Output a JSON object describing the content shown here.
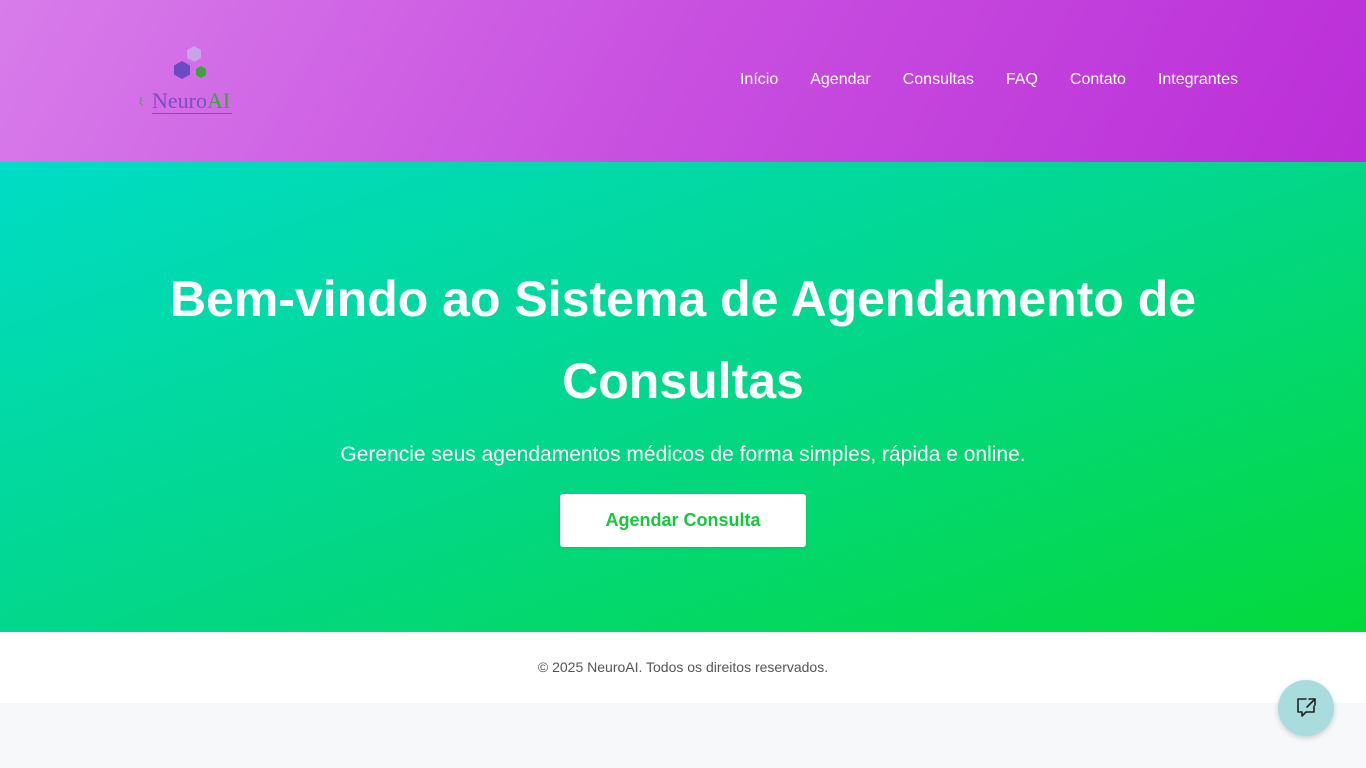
{
  "header": {
    "logo": {
      "name_part1": "Neuro",
      "name_part2": "AI",
      "small_mark": "ξ"
    },
    "nav": [
      "Início",
      "Agendar",
      "Consultas",
      "FAQ",
      "Contato",
      "Integrantes"
    ]
  },
  "hero": {
    "title": "Bem-vindo ao Sistema de Agendamento de Consultas",
    "subtitle": "Gerencie seus agendamentos médicos de forma simples, rápida e online.",
    "cta_label": "Agendar Consulta"
  },
  "footer": {
    "copyright": "© 2025 NeuroAI. Todos os direitos reservados."
  },
  "icons": {
    "logo": "hexagon-cluster-icon",
    "chat": "chat-external-icon"
  },
  "colors": {
    "header_gradient_start": "#d87cea",
    "header_gradient_end": "#bb2ed8",
    "hero_gradient_start": "#00dcc6",
    "hero_gradient_end": "#04d93a",
    "cta_text": "#17c63c",
    "chat_button": "#a9dcdc"
  }
}
